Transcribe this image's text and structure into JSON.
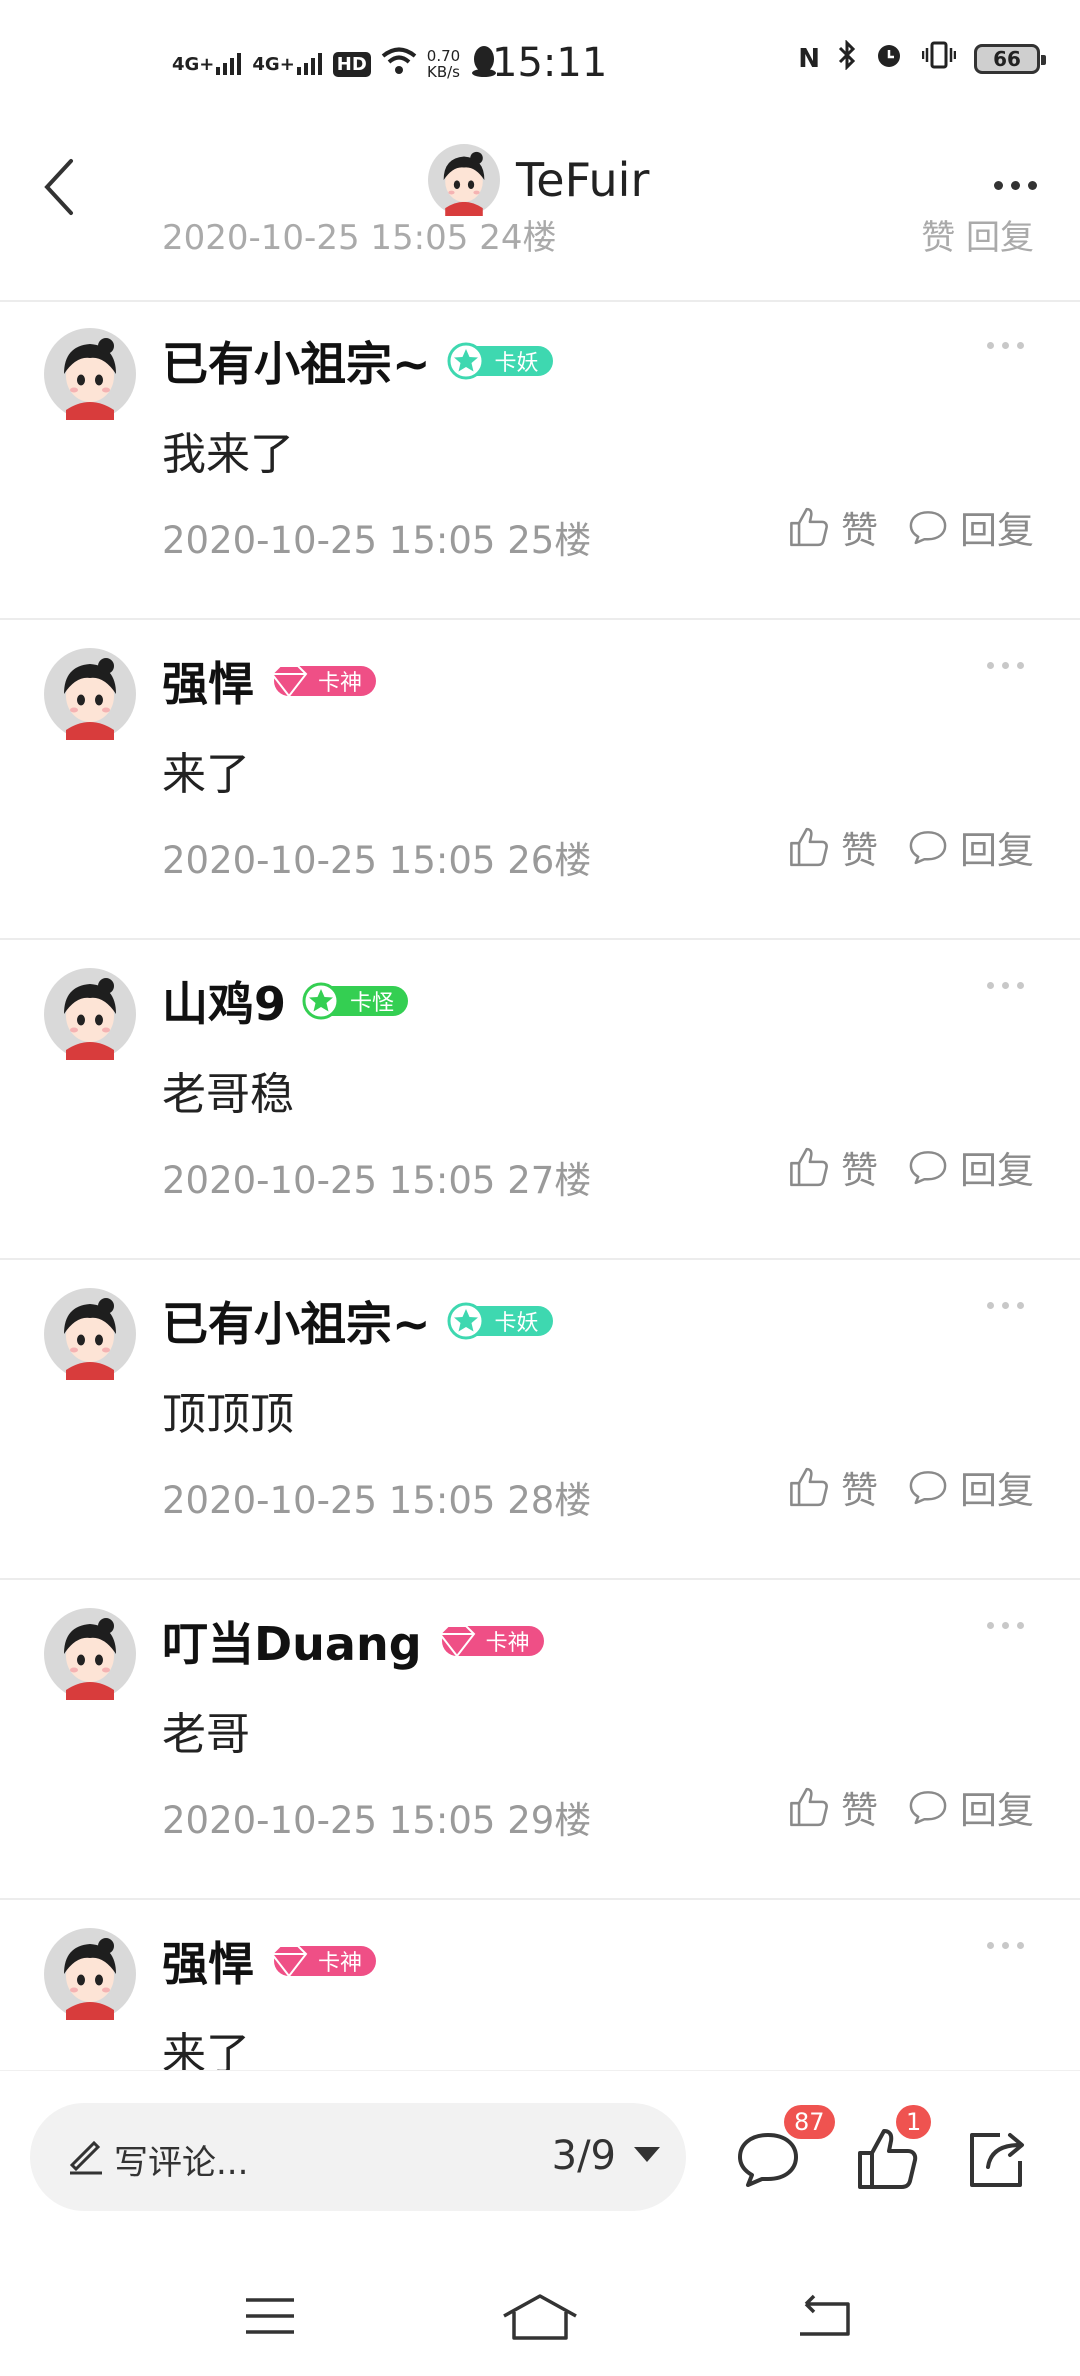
{
  "status_bar": {
    "signal1": "4G+",
    "signal2": "4G+",
    "hd": "HD",
    "speed_value": "0.70",
    "speed_unit": "KB/s",
    "time": "15:11",
    "battery": "66"
  },
  "header": {
    "title": "TeFuir"
  },
  "partial_top_row": {
    "meta": "2020-10-25 15:05 24楼",
    "actions": "赞  回复"
  },
  "comments": [
    {
      "username": "已有小祖宗~",
      "badge": "卡妖",
      "badge_color": "#3ed8b0",
      "text": "我来了",
      "time": "2020-10-25 15:05",
      "floor": "25楼",
      "like": "赞",
      "reply": "回复"
    },
    {
      "username": "强悍",
      "badge": "卡神",
      "badge_color": "#ef4f86",
      "text": "来了",
      "time": "2020-10-25 15:05",
      "floor": "26楼",
      "like": "赞",
      "reply": "回复"
    },
    {
      "username": "山鸡9",
      "badge": "卡怪",
      "badge_color": "#34cf52",
      "text": "老哥稳",
      "time": "2020-10-25 15:05",
      "floor": "27楼",
      "like": "赞",
      "reply": "回复"
    },
    {
      "username": "已有小祖宗~",
      "badge": "卡妖",
      "badge_color": "#3ed8b0",
      "text": "顶顶顶",
      "time": "2020-10-25 15:05",
      "floor": "28楼",
      "like": "赞",
      "reply": "回复"
    },
    {
      "username": "叮当Duang",
      "badge": "卡神",
      "badge_color": "#ef4f86",
      "text": "老哥",
      "time": "2020-10-25 15:05",
      "floor": "29楼",
      "like": "赞",
      "reply": "回复"
    },
    {
      "username": "强悍",
      "badge": "卡神",
      "badge_color": "#ef4f86",
      "text": "来了",
      "time": "",
      "floor": "",
      "like": "",
      "reply": ""
    }
  ],
  "bottom_bar": {
    "placeholder": "写评论...",
    "page": "3/9",
    "comment_count": "87",
    "like_count": "1"
  }
}
